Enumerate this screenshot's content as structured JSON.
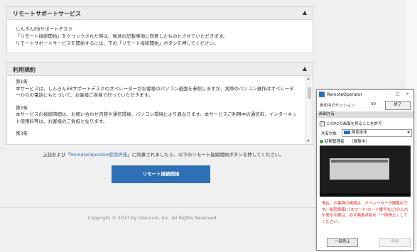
{
  "support_panel": {
    "title": "リモートサポートサービス",
    "lines": [
      "しんきんEBサポートデスク",
      "「リモート接続開始」をクリックされた時は、後述の記載事項に同意したものとさせていただきます。",
      "リモートサポートサービスを開始するには、下の「リモート接続開始」ボタンを押してください。"
    ]
  },
  "terms_panel": {
    "title": "利用規約",
    "sections": [
      {
        "heading": "第1条",
        "text": "本サービスは、しんきんEBサポートデスクのオペレーターがお客様のパソコン画面を参照しますが、実際のパソコン操作はオペレーターからの電話にもとづいて、お客様ご自身で行っていただきます。"
      },
      {
        "heading": "第2条",
        "text": "本サービスの接続時間は、お問い合わせ内容や通信環境、パソコン環境により異なります。本サービスご利用中の通信料、インターネット使用料等は、お客様のご負担となります。"
      },
      {
        "heading": "第3条",
        "text": ""
      }
    ]
  },
  "agree": {
    "prefix": "上記および「",
    "link": "RemoteOperator使用許諾",
    "suffix": "」に同意されましたら、以下のリモート接続開始ボタンを押してください。"
  },
  "start_button": "リモート接続開始",
  "footer": "Copyright © 2017 by Intercom, Inc. All Rights Reserved.",
  "remote_operator": {
    "title": "RemoteOperator",
    "controls": [
      "–",
      "□",
      "×"
    ],
    "session_label": "参加中のセッション",
    "session_count": "39",
    "end_button": "終了",
    "section": "画面共有",
    "allow_checkbox": "このPCの画面を見ることを許可",
    "allow_checked": true,
    "target_label": "共有対象",
    "target_value": "画面全体",
    "admin_label": "初期管理者",
    "admin_status": "［閲覧中］",
    "notice": "現在、お客様の画面は、オペレーターが閲覧中です。秘密情報(パスワード/カード番号など)の入力や表示の際は、必ず画面共有を「一時停止」してください。",
    "pause_button": "一時停止",
    "resume_button": "再開"
  },
  "colors": {
    "accent": "#2e6fb5",
    "link": "#2a6eb5",
    "notice": "#e02020",
    "panel_header": "#ececec",
    "background": "#f0f0f0"
  }
}
